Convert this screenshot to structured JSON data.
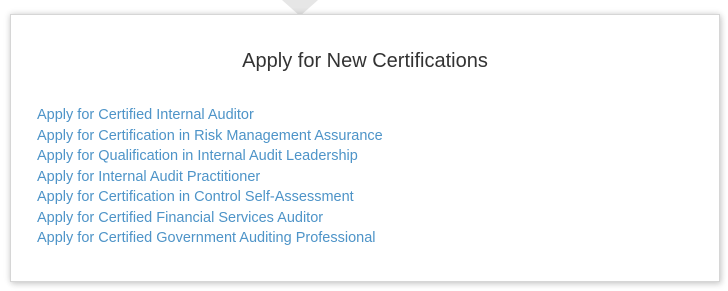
{
  "panel": {
    "title": "Apply for New Certifications",
    "links": [
      {
        "label": "Apply for Certified Internal Auditor"
      },
      {
        "label": "Apply for Certification in Risk Management Assurance"
      },
      {
        "label": "Apply for Qualification in Internal Audit Leadership"
      },
      {
        "label": "Apply for Internal Audit Practitioner"
      },
      {
        "label": "Apply for Certification in Control Self-Assessment"
      },
      {
        "label": "Apply for Certified Financial Services Auditor"
      },
      {
        "label": "Apply for Certified Government Auditing Professional"
      }
    ]
  },
  "colors": {
    "link": "#4e94c8",
    "title": "#333333",
    "border": "#d6d6d6",
    "background": "#ffffff"
  }
}
